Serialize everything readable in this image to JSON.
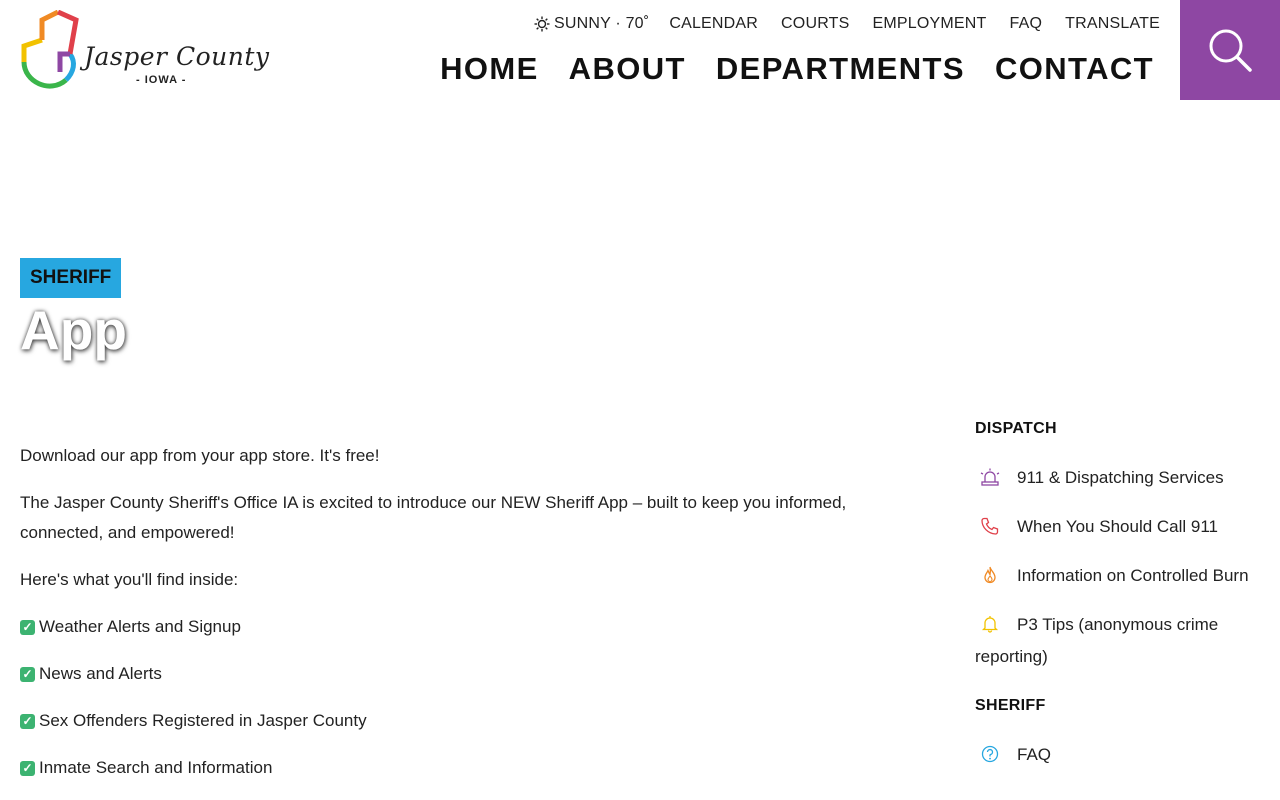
{
  "site": {
    "logo": {
      "name": "Jasper County",
      "state": "- IOWA -"
    }
  },
  "header": {
    "weather": {
      "text": "SUNNY · 70˚",
      "icon": "sun-icon"
    },
    "utility_links": [
      "CALENDAR",
      "COURTS",
      "EMPLOYMENT",
      "FAQ",
      "TRANSLATE"
    ],
    "main_nav": [
      "HOME",
      "ABOUT",
      "DEPARTMENTS",
      "CONTACT"
    ],
    "search_icon": "search-icon",
    "search_color": "#8e47a3"
  },
  "hero": {
    "badge": "SHERIFF",
    "badge_color": "#27a7e0",
    "title": "App"
  },
  "content": {
    "paragraphs": [
      "Download our app from your app store. It's free!",
      "The Jasper County Sheriff's Office IA is excited to introduce our NEW Sheriff App – built to keep you informed, connected, and empowered!",
      "Here's what you'll find inside:"
    ],
    "features": [
      "Weather Alerts and Signup",
      "News and Alerts",
      "Sex Offenders Registered in Jasper County",
      "Inmate Search and Information"
    ],
    "check_icon": "checkmark-icon"
  },
  "sidebar": {
    "sections": [
      {
        "heading": "DISPATCH",
        "links": [
          {
            "label": "911 & Dispatching Services",
            "icon": "siren-icon",
            "color": "#8e47a3"
          },
          {
            "label": "When You Should Call 911",
            "icon": "phone-icon",
            "color": "#e0404a"
          },
          {
            "label": "Information on Controlled Burn",
            "icon": "flame-icon",
            "color": "#f08a24"
          },
          {
            "label": "P3 Tips (anonymous crime reporting)",
            "icon": "bell-icon",
            "color": "#f2c200"
          }
        ]
      },
      {
        "heading": "SHERIFF",
        "links": [
          {
            "label": "FAQ",
            "icon": "question-circle-icon",
            "color": "#27a7e0"
          }
        ]
      }
    ]
  }
}
